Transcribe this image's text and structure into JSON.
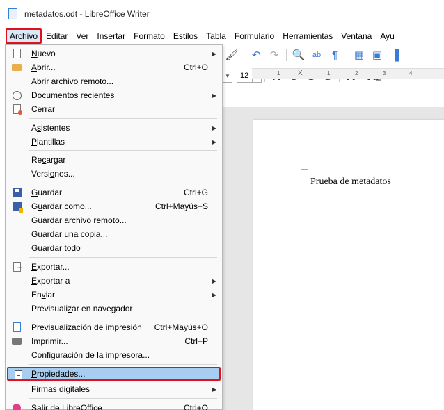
{
  "window": {
    "title": "metadatos.odt - LibreOffice Writer"
  },
  "menubar": {
    "items": [
      {
        "pre": "",
        "u": "A",
        "post": "rchivo"
      },
      {
        "pre": "",
        "u": "E",
        "post": "ditar"
      },
      {
        "pre": "",
        "u": "V",
        "post": "er"
      },
      {
        "pre": "",
        "u": "I",
        "post": "nsertar"
      },
      {
        "pre": "",
        "u": "F",
        "post": "ormato"
      },
      {
        "pre": "E",
        "u": "s",
        "post": "tilos"
      },
      {
        "pre": "",
        "u": "T",
        "post": "abla"
      },
      {
        "pre": "F",
        "u": "o",
        "post": "rmulario"
      },
      {
        "pre": "",
        "u": "H",
        "post": "erramientas"
      },
      {
        "pre": "Ve",
        "u": "n",
        "post": "tana"
      },
      {
        "pre": "Ayu",
        "u": "",
        "post": ""
      }
    ]
  },
  "toolbar": {
    "font_size": "12",
    "format_buttons": [
      "N",
      "C",
      "S",
      "S",
      "X²",
      "X₂"
    ]
  },
  "ruler": {
    "ticks": [
      "1",
      "X",
      "1",
      "2",
      "3",
      "4"
    ]
  },
  "document": {
    "text": "Prueba de metadatos"
  },
  "file_menu": {
    "items": [
      {
        "pre": "",
        "u": "N",
        "post": "uevo",
        "shortcut": "",
        "submenu": true
      },
      {
        "pre": "",
        "u": "A",
        "post": "brir...",
        "shortcut": "Ctrl+O",
        "submenu": false
      },
      {
        "pre": "Abrir archivo ",
        "u": "r",
        "post": "emoto...",
        "shortcut": "",
        "submenu": false
      },
      {
        "pre": "",
        "u": "D",
        "post": "ocumentos recientes",
        "shortcut": "",
        "submenu": true
      },
      {
        "pre": "",
        "u": "C",
        "post": "errar",
        "shortcut": "",
        "submenu": false
      },
      {
        "pre": "A",
        "u": "s",
        "post": "istentes",
        "shortcut": "",
        "submenu": true
      },
      {
        "pre": "",
        "u": "P",
        "post": "lantillas",
        "shortcut": "",
        "submenu": true
      },
      {
        "pre": "Re",
        "u": "c",
        "post": "argar",
        "shortcut": "",
        "submenu": false
      },
      {
        "pre": "Versi",
        "u": "o",
        "post": "nes...",
        "shortcut": "",
        "submenu": false
      },
      {
        "pre": "",
        "u": "G",
        "post": "uardar",
        "shortcut": "Ctrl+G",
        "submenu": false
      },
      {
        "pre": "G",
        "u": "u",
        "post": "ardar como...",
        "shortcut": "Ctrl+Mayús+S",
        "submenu": false
      },
      {
        "pre": "Guardar archivo remoto...",
        "u": "",
        "post": "",
        "shortcut": "",
        "submenu": false
      },
      {
        "pre": "Guardar una copia...",
        "u": "",
        "post": "",
        "shortcut": "",
        "submenu": false
      },
      {
        "pre": "Guardar ",
        "u": "t",
        "post": "odo",
        "shortcut": "",
        "submenu": false
      },
      {
        "pre": "",
        "u": "E",
        "post": "xportar...",
        "shortcut": "",
        "submenu": false
      },
      {
        "pre": "",
        "u": "E",
        "post": "xportar a",
        "shortcut": "",
        "submenu": true
      },
      {
        "pre": "En",
        "u": "v",
        "post": "iar",
        "shortcut": "",
        "submenu": true
      },
      {
        "pre": "Previsuali",
        "u": "z",
        "post": "ar en navegador",
        "shortcut": "",
        "submenu": false
      },
      {
        "pre": "Previsualización de ",
        "u": "i",
        "post": "mpresión",
        "shortcut": "Ctrl+Mayús+O",
        "submenu": false
      },
      {
        "pre": "",
        "u": "I",
        "post": "mprimir...",
        "shortcut": "Ctrl+P",
        "submenu": false
      },
      {
        "pre": "Confi",
        "u": "g",
        "post": "uración de la impresora...",
        "shortcut": "",
        "submenu": false
      },
      {
        "pre": "",
        "u": "P",
        "post": "ropiedades...",
        "shortcut": "",
        "submenu": false
      },
      {
        "pre": "Firmas digitales",
        "u": "",
        "post": "",
        "shortcut": "",
        "submenu": true
      },
      {
        "pre": "",
        "u": "S",
        "post": "alir de LibreOffice",
        "shortcut": "Ctrl+Q",
        "submenu": false
      }
    ]
  },
  "colors": {
    "highlight": "#a7cef0",
    "callout": "#e0101e"
  }
}
